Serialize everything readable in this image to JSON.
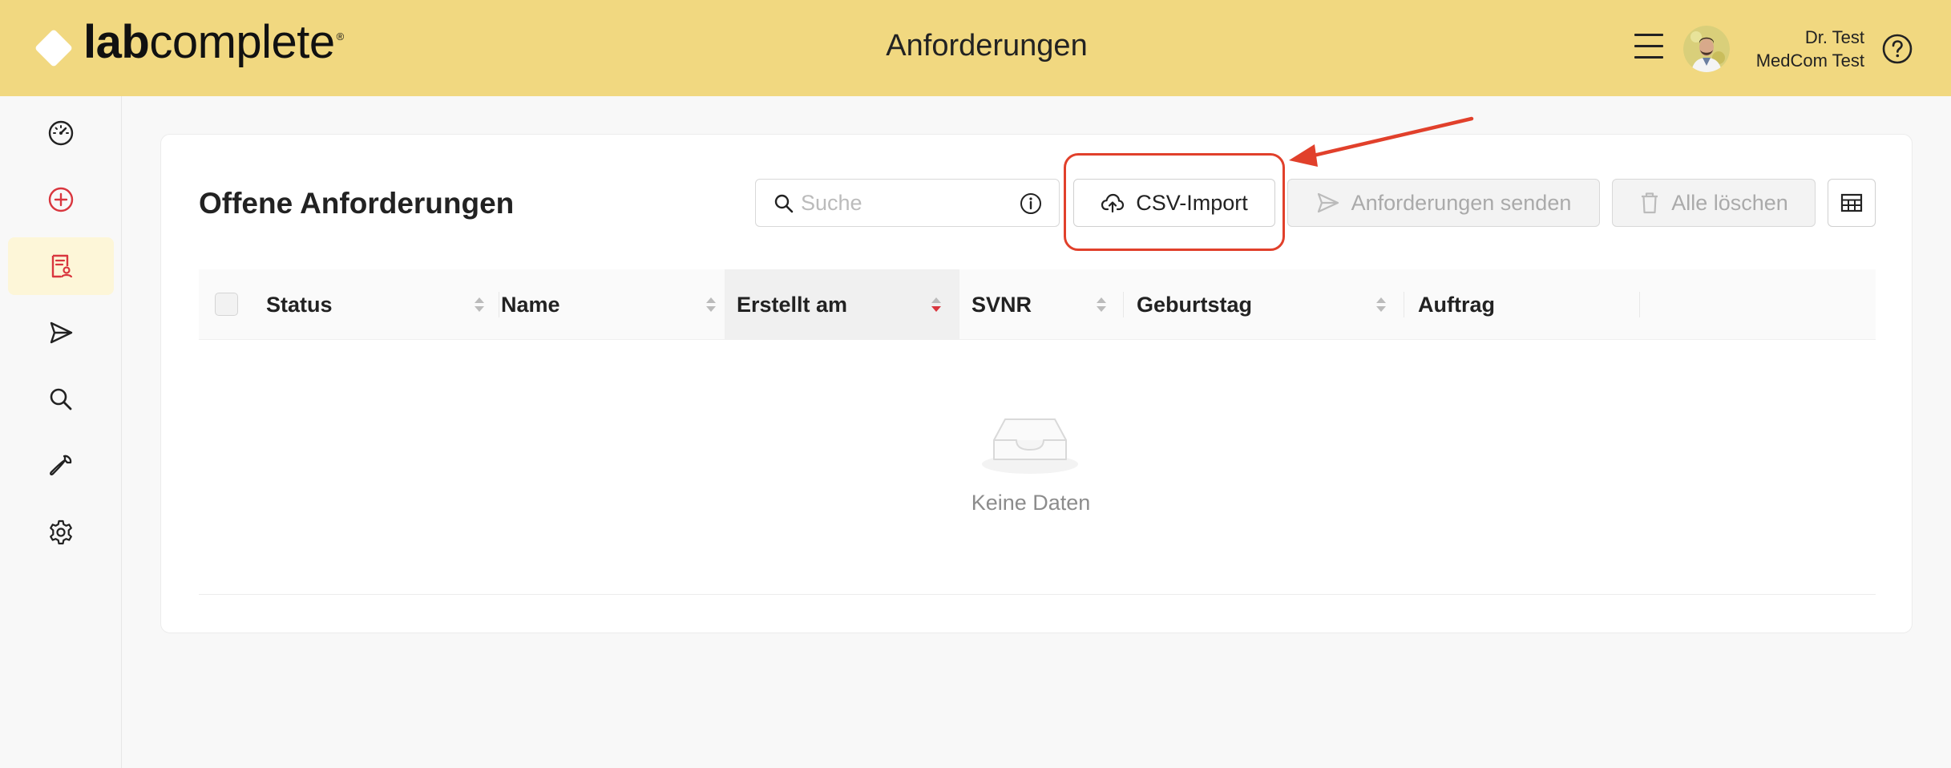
{
  "header": {
    "logo_bold": "lab",
    "logo_light": "complete",
    "logo_reg": "®",
    "title": "Anforderungen",
    "user_line1": "Dr. Test",
    "user_line2": "MedCom Test"
  },
  "sidebar": {
    "items": [
      {
        "icon": "dashboard-gauge-icon"
      },
      {
        "icon": "add-circle-icon"
      },
      {
        "icon": "requisition-document-icon",
        "active": true
      },
      {
        "icon": "send-icon"
      },
      {
        "icon": "search-icon"
      },
      {
        "icon": "wrench-icon"
      },
      {
        "icon": "settings-gear-icon"
      }
    ]
  },
  "main": {
    "title": "Offene Anforderungen",
    "search_placeholder": "Suche",
    "csv_import_label": "CSV-Import",
    "send_label": "Anforderungen senden",
    "delete_all_label": "Alle löschen",
    "columns": [
      {
        "label": "Status"
      },
      {
        "label": "Name"
      },
      {
        "label": "Erstellt am",
        "sorted": "descending"
      },
      {
        "label": "SVNR"
      },
      {
        "label": "Geburtstag"
      },
      {
        "label": "Auftrag"
      }
    ],
    "empty_text": "Keine Daten"
  },
  "colors": {
    "header_bg": "#f1d880",
    "accent_red": "#d9363e",
    "annotation_red": "#e1402b"
  }
}
